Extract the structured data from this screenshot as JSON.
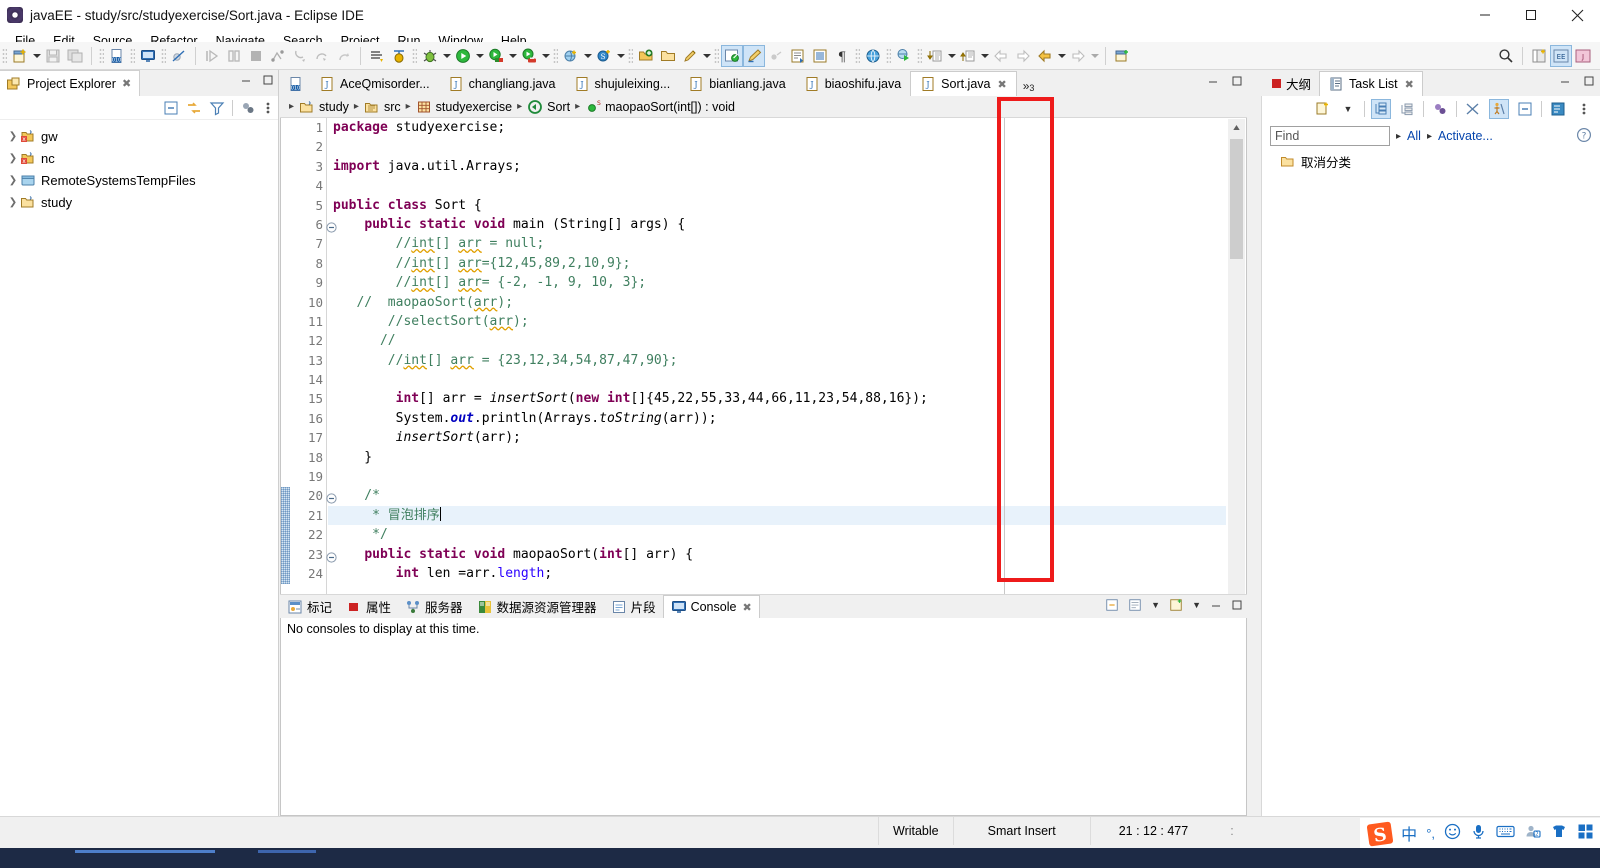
{
  "window": {
    "title": "javaEE - study/src/studyexercise/Sort.java - Eclipse IDE",
    "app_icon": "eclipse-icon",
    "minimize": "minimize-icon",
    "maximize": "maximize-icon",
    "close": "close-icon"
  },
  "menubar": {
    "items": [
      {
        "label": "File",
        "mnemonic": "F"
      },
      {
        "label": "Edit",
        "mnemonic": "E"
      },
      {
        "label": "Source",
        "mnemonic": "S"
      },
      {
        "label": "Refactor",
        "mnemonic": "t"
      },
      {
        "label": "Navigate",
        "mnemonic": "N"
      },
      {
        "label": "Search",
        "mnemonic": "a"
      },
      {
        "label": "Project",
        "mnemonic": "P"
      },
      {
        "label": "Run",
        "mnemonic": "R"
      },
      {
        "label": "Window",
        "mnemonic": "W"
      },
      {
        "label": "Help",
        "mnemonic": "H"
      }
    ]
  },
  "toolbar": {
    "buttons": [
      "new-wizard-icon",
      "new-dropdown-arrow",
      "save-icon",
      "save-all-icon",
      "new-java-class-icon",
      "open-console-icon",
      "disable-breakpoints-icon",
      "resume-icon",
      "suspend-icon",
      "terminate-icon",
      "disconnect-icon",
      "step-into-icon",
      "step-over-icon",
      "step-return-icon",
      "skip-all-breakpoints-icon",
      "debug-last-icon",
      "debug-icon",
      "run-icon",
      "run-coverage-icon",
      "run-external-icon",
      "new-server-icon",
      "search-icon",
      "open-type-icon",
      "open-folder-icon",
      "pencil-icon",
      "toggle-mark-occurrences-icon",
      "link-with-editor-icon",
      "next-annotation-icon",
      "previous-annotation-icon",
      "last-edit-location-icon",
      "show-whitespace-icon",
      "browser-icon",
      "external-tools-icon",
      "open-declaration-icon",
      "open-declaration-arrow",
      "back-icon",
      "forward-icon",
      "back-history-icon",
      "back-history-arrow",
      "forward-history-icon",
      "forward-history-arrow",
      "new-editor-icon",
      "search-magnifier-icon",
      "perspective-java-icon",
      "perspective-javaee-icon",
      "perspective-open-icon"
    ]
  },
  "project_explorer": {
    "tab_label": "Project Explorer",
    "tab_icon": "project-explorer-icon",
    "tab_close": "close-icon",
    "view_minimize": "minimize-icon",
    "view_maximize": "maximize-icon",
    "toolbar_icons": [
      "collapse-all-icon",
      "link-with-editor-icon",
      "view-filter-icon",
      "view-layout-icon",
      "view-menu-icon"
    ],
    "tree": [
      {
        "label": "gw",
        "icon": "java-project-closed-icon",
        "expanded": false
      },
      {
        "label": "nc",
        "icon": "java-project-closed-icon",
        "expanded": false
      },
      {
        "label": "RemoteSystemsTempFiles",
        "icon": "folder-project-icon",
        "expanded": false
      },
      {
        "label": "study",
        "icon": "java-project-open-icon",
        "expanded": false
      }
    ]
  },
  "editor": {
    "leading_icon": "new-java-class-icon",
    "tabs": [
      {
        "label": "AceQmisorder...",
        "icon": "java-file-icon",
        "selected": false
      },
      {
        "label": "changliang.java",
        "icon": "java-file-icon",
        "selected": false
      },
      {
        "label": "shujuleixing...",
        "icon": "java-file-icon",
        "selected": false
      },
      {
        "label": "bianliang.java",
        "icon": "java-file-icon",
        "selected": false
      },
      {
        "label": "biaoshifu.java",
        "icon": "java-file-icon",
        "selected": false
      },
      {
        "label": "Sort.java",
        "icon": "java-file-icon",
        "selected": true,
        "close": "close-icon"
      }
    ],
    "overflow_label": "»",
    "overflow_count": "3",
    "minimize": "minimize-icon",
    "maximize": "maximize-icon",
    "breadcrumb": [
      {
        "label": "study",
        "icon": "java-project-open-icon"
      },
      {
        "label": "src",
        "icon": "source-folder-icon"
      },
      {
        "label": "studyexercise",
        "icon": "package-icon"
      },
      {
        "label": "Sort",
        "icon": "class-icon"
      },
      {
        "label": "maopaoSort(int[]) : void",
        "icon": "method-static-icon"
      }
    ],
    "lines": [
      {
        "n": "1",
        "fold": false,
        "changed": false,
        "highlight": false,
        "tokens": [
          {
            "t": "package ",
            "c": "kw"
          },
          {
            "t": "studyexercise;",
            "c": ""
          }
        ]
      },
      {
        "n": "2",
        "fold": false,
        "changed": false,
        "highlight": false,
        "tokens": []
      },
      {
        "n": "3",
        "fold": false,
        "changed": false,
        "highlight": false,
        "tokens": [
          {
            "t": "import ",
            "c": "kw"
          },
          {
            "t": "java.util.Arrays;",
            "c": ""
          }
        ]
      },
      {
        "n": "4",
        "fold": false,
        "changed": false,
        "highlight": false,
        "tokens": []
      },
      {
        "n": "5",
        "fold": false,
        "changed": false,
        "highlight": false,
        "tokens": [
          {
            "t": "public class ",
            "c": "kw"
          },
          {
            "t": "Sort {",
            "c": ""
          }
        ]
      },
      {
        "n": "6",
        "fold": true,
        "changed": false,
        "highlight": false,
        "tokens": [
          {
            "t": "    ",
            "c": ""
          },
          {
            "t": "public static void ",
            "c": "kw"
          },
          {
            "t": "main (String[] args) {",
            "c": ""
          }
        ]
      },
      {
        "n": "7",
        "fold": false,
        "changed": false,
        "highlight": false,
        "tokens": [
          {
            "t": "        //",
            "c": "cm"
          },
          {
            "t": "int",
            "c": "cm warnu"
          },
          {
            "t": "[] ",
            "c": "cm"
          },
          {
            "t": "arr",
            "c": "cm warnu"
          },
          {
            "t": " = null;",
            "c": "cm"
          }
        ]
      },
      {
        "n": "8",
        "fold": false,
        "changed": false,
        "highlight": false,
        "tokens": [
          {
            "t": "        //",
            "c": "cm"
          },
          {
            "t": "int",
            "c": "cm warnu"
          },
          {
            "t": "[] ",
            "c": "cm"
          },
          {
            "t": "arr",
            "c": "cm warnu"
          },
          {
            "t": "={12,45,89,2,10,9};",
            "c": "cm"
          }
        ]
      },
      {
        "n": "9",
        "fold": false,
        "changed": false,
        "highlight": false,
        "tokens": [
          {
            "t": "        //",
            "c": "cm"
          },
          {
            "t": "int",
            "c": "cm warnu"
          },
          {
            "t": "[] ",
            "c": "cm"
          },
          {
            "t": "arr",
            "c": "cm warnu"
          },
          {
            "t": "= {-2, -1, 9, 10, 3};",
            "c": "cm"
          }
        ]
      },
      {
        "n": "10",
        "fold": false,
        "changed": false,
        "highlight": false,
        "tokens": [
          {
            "t": "   //  maopaoSort(",
            "c": "cm"
          },
          {
            "t": "arr",
            "c": "cm warnu"
          },
          {
            "t": ");",
            "c": "cm"
          }
        ]
      },
      {
        "n": "11",
        "fold": false,
        "changed": false,
        "highlight": false,
        "tokens": [
          {
            "t": "       //selectSort(",
            "c": "cm"
          },
          {
            "t": "arr",
            "c": "cm warnu"
          },
          {
            "t": ");",
            "c": "cm"
          }
        ]
      },
      {
        "n": "12",
        "fold": false,
        "changed": false,
        "highlight": false,
        "tokens": [
          {
            "t": "      //",
            "c": "cm"
          }
        ]
      },
      {
        "n": "13",
        "fold": false,
        "changed": false,
        "highlight": false,
        "tokens": [
          {
            "t": "       //",
            "c": "cm"
          },
          {
            "t": "int",
            "c": "cm warnu"
          },
          {
            "t": "[] ",
            "c": "cm"
          },
          {
            "t": "arr",
            "c": "cm warnu"
          },
          {
            "t": " = {23,12,34,54,87,47,90};",
            "c": "cm"
          }
        ]
      },
      {
        "n": "14",
        "fold": false,
        "changed": false,
        "highlight": false,
        "tokens": []
      },
      {
        "n": "15",
        "fold": false,
        "changed": false,
        "highlight": false,
        "tokens": [
          {
            "t": "        ",
            "c": ""
          },
          {
            "t": "int",
            "c": "kw"
          },
          {
            "t": "[] arr = ",
            "c": ""
          },
          {
            "t": "insertSort",
            "c": "mth"
          },
          {
            "t": "(",
            "c": ""
          },
          {
            "t": "new int",
            "c": "kw"
          },
          {
            "t": "[]{45,22,55,33,44,66,11,23,54,88,16});",
            "c": ""
          }
        ]
      },
      {
        "n": "16",
        "fold": false,
        "changed": false,
        "highlight": false,
        "tokens": [
          {
            "t": "        System.",
            "c": ""
          },
          {
            "t": "out",
            "c": "fld"
          },
          {
            "t": ".println(Arrays.",
            "c": ""
          },
          {
            "t": "toString",
            "c": "mth"
          },
          {
            "t": "(arr));",
            "c": ""
          }
        ]
      },
      {
        "n": "17",
        "fold": false,
        "changed": false,
        "highlight": false,
        "tokens": [
          {
            "t": "        ",
            "c": ""
          },
          {
            "t": "insertSort",
            "c": "mth"
          },
          {
            "t": "(arr);",
            "c": ""
          }
        ]
      },
      {
        "n": "18",
        "fold": false,
        "changed": false,
        "highlight": false,
        "tokens": [
          {
            "t": "    }",
            "c": ""
          }
        ]
      },
      {
        "n": "19",
        "fold": false,
        "changed": false,
        "highlight": false,
        "tokens": []
      },
      {
        "n": "20",
        "fold": true,
        "changed": true,
        "highlight": false,
        "tokens": [
          {
            "t": "    /*",
            "c": "cm"
          }
        ]
      },
      {
        "n": "21",
        "fold": false,
        "changed": true,
        "highlight": true,
        "tokens": [
          {
            "t": "     * 冒泡排序",
            "c": "cm"
          }
        ],
        "caret": true
      },
      {
        "n": "22",
        "fold": false,
        "changed": true,
        "highlight": false,
        "tokens": [
          {
            "t": "     */",
            "c": "cm"
          }
        ]
      },
      {
        "n": "23",
        "fold": true,
        "changed": true,
        "highlight": false,
        "tokens": [
          {
            "t": "    ",
            "c": ""
          },
          {
            "t": "public static void ",
            "c": "kw"
          },
          {
            "t": "maopaoSort(",
            "c": ""
          },
          {
            "t": "int",
            "c": "kw"
          },
          {
            "t": "[] arr) {",
            "c": ""
          }
        ]
      },
      {
        "n": "24",
        "fold": false,
        "changed": true,
        "highlight": false,
        "tokens": [
          {
            "t": "        ",
            "c": ""
          },
          {
            "t": "int",
            "c": "kw"
          },
          {
            "t": " len =arr.",
            "c": ""
          },
          {
            "t": "length",
            "c": "st"
          },
          {
            "t": ";",
            "c": ""
          }
        ]
      }
    ],
    "annotation_box": {
      "color": "#ee1b1b",
      "label": "print-margin-highlight"
    }
  },
  "bottom_panel": {
    "tabs": [
      {
        "label": "标记",
        "icon": "markers-icon",
        "selected": false
      },
      {
        "label": "属性",
        "icon": "properties-icon",
        "selected": false
      },
      {
        "label": "服务器",
        "icon": "servers-icon",
        "selected": false
      },
      {
        "label": "数据源资源管理器",
        "icon": "data-source-explorer-icon",
        "selected": false
      },
      {
        "label": "片段",
        "icon": "snippets-icon",
        "selected": false
      },
      {
        "label": "Console",
        "icon": "console-icon",
        "selected": true,
        "close": "close-icon"
      }
    ],
    "controls": [
      "pin-console-icon",
      "minimize-icon",
      "display-selected-console-icon",
      "dropdown-arrow",
      "open-console-icon",
      "view-minimize-icon",
      "view-maximize-icon"
    ],
    "body_text": "No consoles to display at this time."
  },
  "right_panel": {
    "tabs": [
      {
        "label": "大纲",
        "icon": "outline-icon",
        "selected": false
      },
      {
        "label": "Task List",
        "icon": "task-list-icon",
        "selected": true,
        "close": "close-icon"
      }
    ],
    "minimize": "minimize-icon",
    "maximize": "maximize-icon",
    "toolbar_icons": [
      "new-task-icon",
      "new-task-dropdown-arrow",
      "categorized-presentation-icon",
      "scheduled-presentation-icon",
      "focus-on-workweek-icon",
      "synchronize-icon",
      "show-ui-legend-icon",
      "collapse-all-icon",
      "restore-task-icon",
      "view-menu-icon"
    ],
    "find_placeholder": "Find",
    "filter_all": "All",
    "filter_activate": "Activate...",
    "help_icon": "help-icon",
    "items": [
      {
        "label": "取消分类",
        "icon": "folder-open-icon"
      }
    ]
  },
  "statusbar": {
    "writable": "Writable",
    "insert_mode": "Smart Insert",
    "position": "21 : 12 : 477",
    "extra": ":"
  },
  "tray": {
    "icons": [
      "sogou-logo-icon",
      "chinese-input-icon",
      "punctuation-icon",
      "emoji-icon",
      "microphone-icon",
      "keyboard-icon",
      "user-account-icon",
      "skin-icon",
      "toolbox-icon"
    ],
    "chinese_label": "中"
  }
}
